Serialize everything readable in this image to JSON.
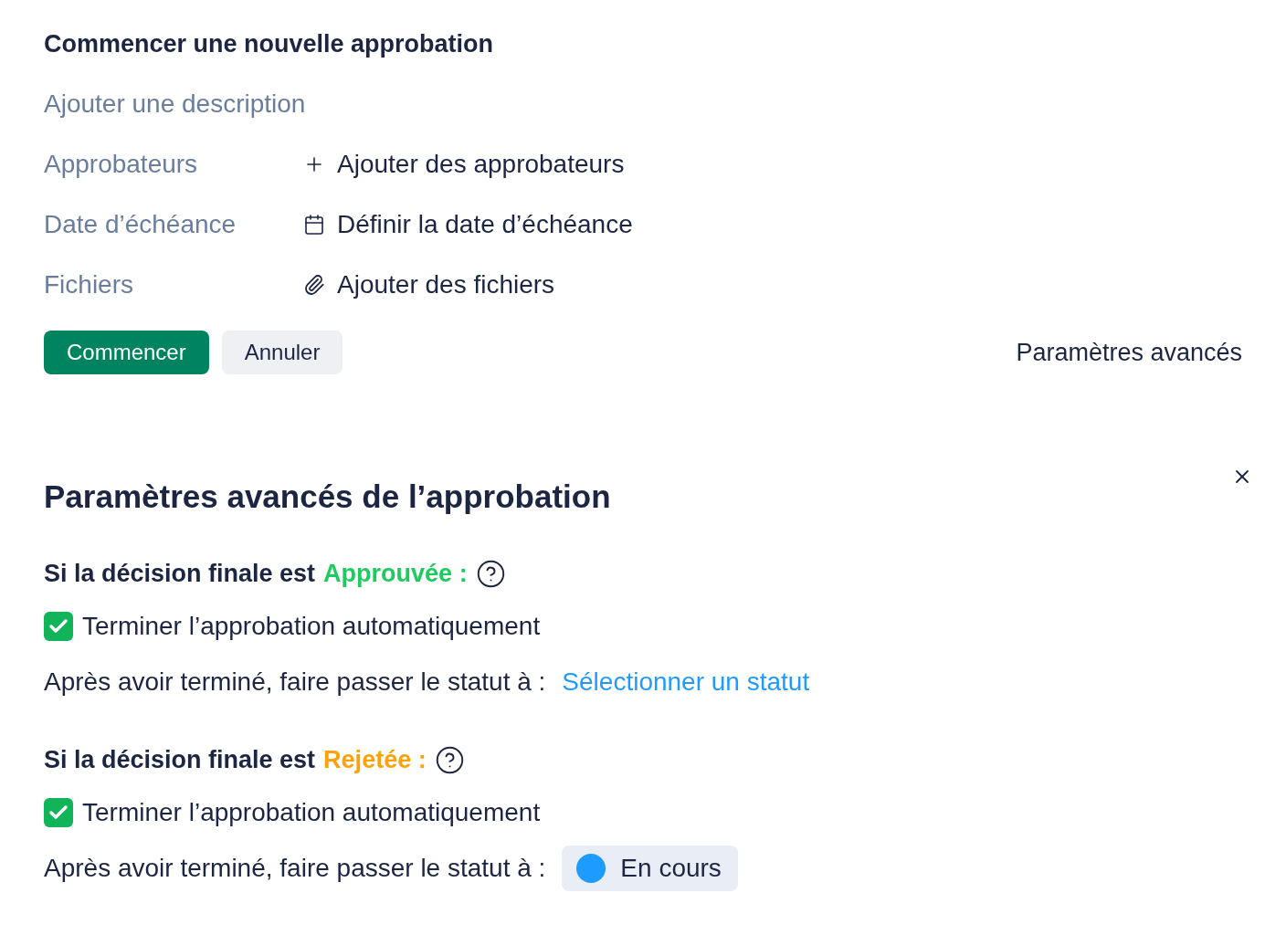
{
  "new_approval": {
    "title": "Commencer une nouvelle approbation",
    "description": {
      "placeholder": "Ajouter une description"
    },
    "fields": [
      {
        "label": "Approbateurs",
        "action": "Ajouter des approbateurs",
        "kind": "add"
      },
      {
        "label": "Date d’échéance",
        "action": "Définir la date d’échéance",
        "kind": "date"
      },
      {
        "label": "Fichiers",
        "action": "Ajouter des fichiers",
        "kind": "files"
      }
    ],
    "buttons": [
      {
        "label": "Commencer",
        "kind": "primary"
      },
      {
        "label": "Annuler",
        "kind": "secondary"
      }
    ],
    "advanced_link": "Paramètres avancés"
  },
  "advanced_settings": {
    "title": "Paramètres avancés de l’approbation",
    "sections": [
      {
        "prefix": "Si la décision finale est",
        "decision": "Approuvée :",
        "color": "#1fcb5f",
        "checkbox": {
          "label": "Terminer l’approbation automatiquement",
          "checked": true
        },
        "status_label": "Après avoir terminé, faire passer le statut à :",
        "status": {
          "kind": "link",
          "text": "Sélectionner un statut"
        }
      },
      {
        "prefix": "Si la décision finale est",
        "decision": "Rejetée :",
        "color": "#ffa20a",
        "checkbox": {
          "label": "Terminer l’approbation automatiquement",
          "checked": true
        },
        "status_label": "Après avoir terminé, faire passer le statut à :",
        "status": {
          "kind": "pill",
          "text": "En cours",
          "color": "#1e9bff"
        }
      }
    ]
  }
}
